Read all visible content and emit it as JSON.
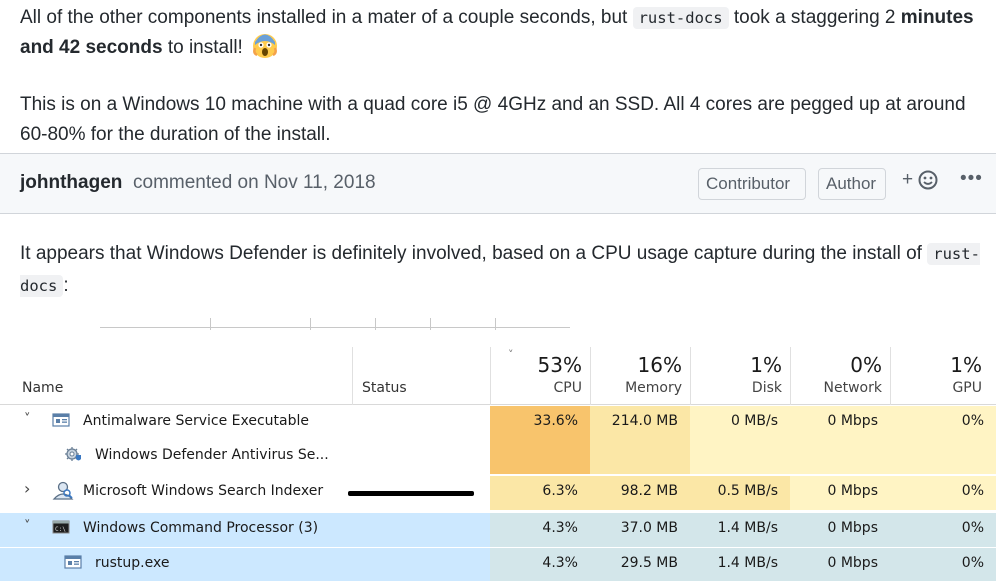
{
  "paragraph1": {
    "before_code": "All of the other components installed in a mater of a couple seconds, but ",
    "code": "rust-docs",
    "after_code": " took a staggering 2 ",
    "bold": "minutes and 42 seconds",
    "after_bold": " to install!"
  },
  "paragraph2": "This is on a Windows 10 machine with a quad core i5 @ 4GHz and an SSD. All 4 cores are pegged up at around 60-80% for the duration of the install.",
  "comment": {
    "author": "johnthagen",
    "meta": "commented on Nov 11, 2018",
    "badges": [
      "Contributor",
      "Author"
    ],
    "reaction_prefix": "+",
    "more": "•••"
  },
  "paragraph3": {
    "text": "It appears that Windows Defender is definitely involved, based on a CPU usage capture during the install of ",
    "code": "rust-docs",
    "after": ":"
  },
  "task_manager": {
    "headers": {
      "name": "Name",
      "status": "Status",
      "columns": [
        {
          "pct": "53%",
          "label": "CPU"
        },
        {
          "pct": "16%",
          "label": "Memory"
        },
        {
          "pct": "1%",
          "label": "Disk"
        },
        {
          "pct": "0%",
          "label": "Network"
        },
        {
          "pct": "1%",
          "label": "GPU"
        }
      ]
    },
    "sort_indicator": "˅",
    "rows": [
      {
        "chevron": "˅",
        "icon": "app-window-icon",
        "name": "Antimalware Service Executable",
        "values": [
          "33.6%",
          "214.0 MB",
          "0 MB/s",
          "0 Mbps",
          "0%"
        ]
      },
      {
        "chevron": "",
        "icon": "gear-shield-icon",
        "name": "Windows Defender Antivirus Se...",
        "values": [
          "",
          "",
          "",
          "",
          ""
        ]
      },
      {
        "chevron": "›",
        "icon": "search-user-icon",
        "name": "Microsoft Windows Search Indexer",
        "values": [
          "6.3%",
          "98.2 MB",
          "0.5 MB/s",
          "0 Mbps",
          "0%"
        ]
      },
      {
        "chevron": "˅",
        "icon": "cmd-icon",
        "name": "Windows Command Processor (3)",
        "values": [
          "4.3%",
          "37.0 MB",
          "1.4 MB/s",
          "0 Mbps",
          "0%"
        ]
      },
      {
        "chevron": "",
        "icon": "app-window-icon",
        "name": "rustup.exe",
        "values": [
          "4.3%",
          "29.5 MB",
          "1.4 MB/s",
          "0 Mbps",
          "0%"
        ]
      }
    ],
    "colors": {
      "heat_high": "#f8c46c",
      "heat_mid": "#fbe7a6",
      "heat_low": "#fff4c4",
      "selected_row": "#cce8ff"
    }
  }
}
